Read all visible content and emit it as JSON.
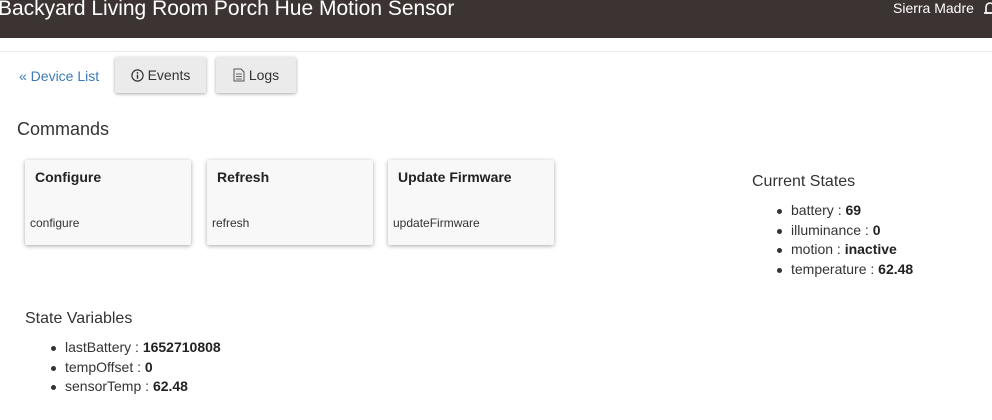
{
  "header": {
    "device_title": "Backyard Living Room Porch Hue Motion Sensor",
    "hub_name": "Sierra Madre"
  },
  "nav": {
    "device_list_label": "« Device List",
    "events_label": "Events",
    "logs_label": "Logs"
  },
  "commands": {
    "title": "Commands",
    "items": [
      {
        "name": "Configure",
        "method": "configure"
      },
      {
        "name": "Refresh",
        "method": "refresh"
      },
      {
        "name": "Update Firmware",
        "method": "updateFirmware"
      }
    ]
  },
  "current_states": {
    "title": "Current States",
    "items": [
      {
        "key": "battery : ",
        "value": "69"
      },
      {
        "key": "illuminance : ",
        "value": "0"
      },
      {
        "key": "motion : ",
        "value": "inactive"
      },
      {
        "key": "temperature : ",
        "value": "62.48"
      }
    ]
  },
  "state_variables": {
    "title": "State Variables",
    "items": [
      {
        "key": "lastBattery : ",
        "value": "1652710808"
      },
      {
        "key": "tempOffset : ",
        "value": "0"
      },
      {
        "key": "sensorTemp : ",
        "value": "62.48"
      }
    ]
  },
  "colors": {
    "header_bg": "#3b3432",
    "link": "#3d7ab7",
    "button_bg": "#ebebeb",
    "card_bg": "#f8f8f8"
  },
  "icons": {
    "events": "info-circle-icon",
    "logs": "document-icon",
    "notifications": "bell-icon"
  }
}
